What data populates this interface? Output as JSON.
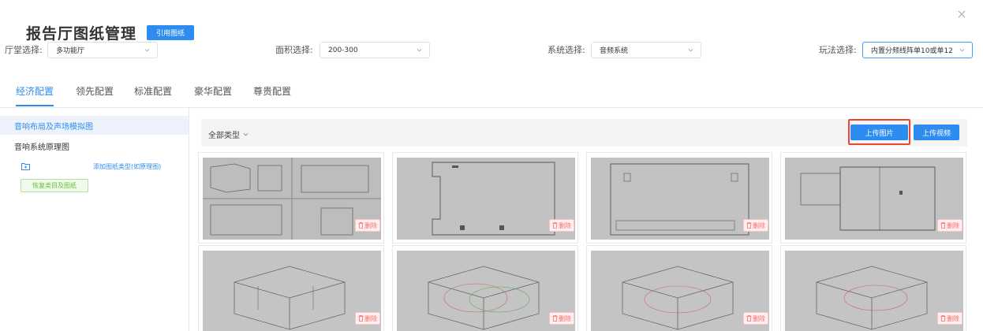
{
  "header": {
    "title": "报告厅图纸管理",
    "cite_button": "引用图纸"
  },
  "filters": [
    {
      "label": "厅堂选择:",
      "value": "多功能厅"
    },
    {
      "label": "面积选择:",
      "value": "200-300"
    },
    {
      "label": "系统选择:",
      "value": "音频系统"
    },
    {
      "label": "玩法选择:",
      "value": "内置分频线阵单10或单12"
    }
  ],
  "tabs": [
    {
      "label": "经济配置",
      "active": true
    },
    {
      "label": "领先配置"
    },
    {
      "label": "标准配置"
    },
    {
      "label": "豪华配置"
    },
    {
      "label": "尊贵配置"
    }
  ],
  "sidebar": {
    "items": [
      {
        "label": "音响布局及声场模拟图",
        "active": true
      },
      {
        "label": "音响系统原理图"
      }
    ],
    "add_type_label": "添加图纸类型(如原理图)",
    "restore_button": "恢复类目及图纸"
  },
  "toolbar": {
    "type_select": "全部类型",
    "upload_image": "上传图片",
    "upload_video": "上传视频"
  },
  "thumbnails": [
    {
      "delete_label": "删除"
    },
    {
      "delete_label": "删除"
    },
    {
      "delete_label": "删除"
    },
    {
      "delete_label": "删除"
    },
    {
      "delete_label": "删除"
    },
    {
      "delete_label": "删除"
    },
    {
      "delete_label": "删除"
    },
    {
      "delete_label": "删除"
    }
  ],
  "colors": {
    "primary": "#2d8cf0",
    "danger": "#f56c6c",
    "highlight": "#ee4433",
    "success": "#67c23a"
  }
}
